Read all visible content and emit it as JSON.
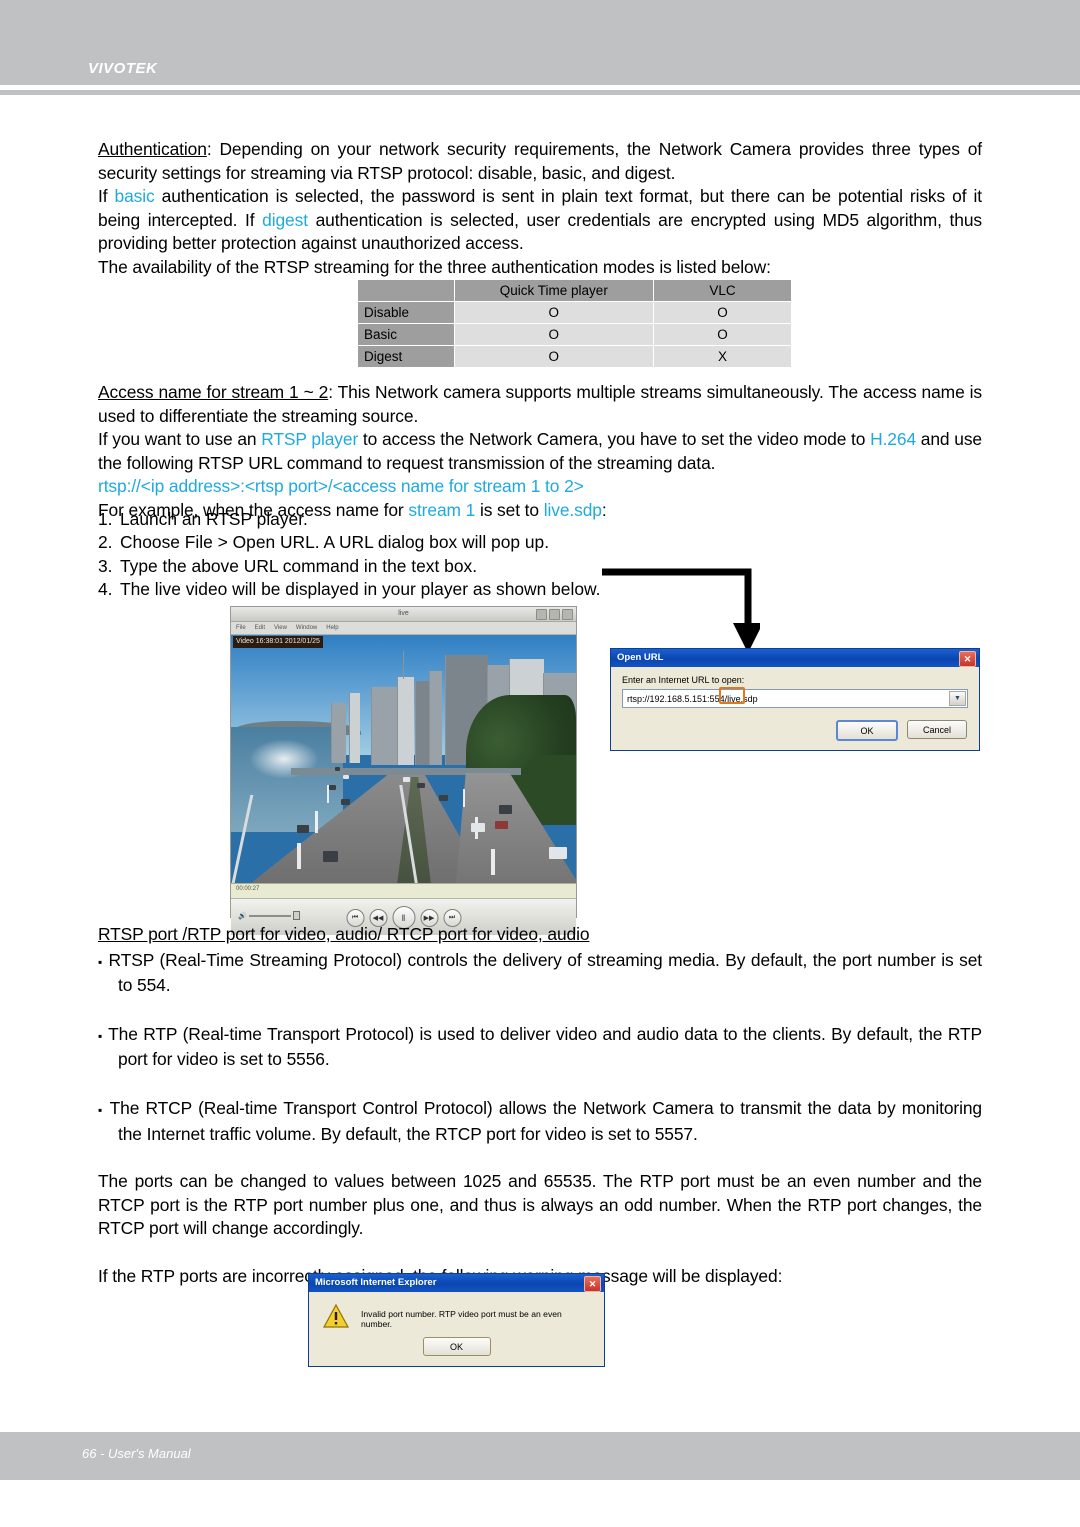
{
  "header": {
    "brand": "VIVOTEK"
  },
  "footer": {
    "page_label": "66 - User's Manual"
  },
  "body": {
    "auth_heading": "Authentication",
    "auth_p1_a": ": Depending on your network security requirements, the Network Camera provides three types of security settings for streaming via RTSP protocol: disable, basic, and digest.",
    "auth_p2_a": "If ",
    "auth_p2_basic": "basic",
    "auth_p2_b": " authentication is selected, the password is sent in plain text format, but there can be potential risks of it being intercepted. If ",
    "auth_p2_digest": "digest",
    "auth_p2_c": " authentication is selected, user credentials are encrypted using MD5 algorithm, thus providing better protection against unauthorized access.",
    "auth_p3": "The availability of the RTSP streaming for the three authentication modes is listed below:",
    "access_heading": "Access name for stream 1 ~ 2",
    "access_p1": ": This Network camera supports multiple streams simultaneously. The access name is used to differentiate the streaming source.",
    "access_p2_a": "If you want to use an ",
    "access_p2_rtsp": "RTSP player",
    "access_p2_b": " to access the Network Camera, you have to set the video mode to ",
    "access_p2_h264": "H.264",
    "access_p2_c": " and use the following RTSP URL command to request transmission of the streaming data.",
    "url_pattern": "rtsp://<ip address>:<rtsp port>/<access name for stream 1 to 2>",
    "example_a": "For example, when the access name for ",
    "example_stream": "stream 1",
    "example_b": " is set to ",
    "example_livesdp": "live.sdp",
    "example_c": ":",
    "ports_heading": "RTSP port /RTP port for video, audio/ RTCP port for video, audio",
    "bullet_rtsp": "RTSP (Real-Time Streaming Protocol) controls the delivery of streaming media. By default, the port number is set to 554.",
    "bullet_rtp": "The RTP (Real-time Transport Protocol) is used to deliver video and audio data to the clients. By default, the RTP port for video is set to 5556.",
    "bullet_rtcp": "The RTCP (Real-time Transport Control Protocol) allows the Network Camera to transmit the data by monitoring the Internet traffic volume. By default, the RTCP port for video is set to 5557.",
    "ports_range_p": "The ports can be changed to values between 1025 and 65535. The RTP port must be an even number and the RTCP port is the RTP port number plus one, and thus is always an odd number. When the RTP port changes, the RTCP port will change accordingly.",
    "warning_intro": "If the RTP ports are incorrectly assigned, the following warning message will be displayed:",
    "bullet_glyph": "▪"
  },
  "steps": [
    {
      "num": "1.",
      "text": "Launch an RTSP player."
    },
    {
      "num": "2.",
      "text": "Choose File > Open URL. A URL dialog box will pop up."
    },
    {
      "num": "3.",
      "text": "Type the above URL command in the text box."
    },
    {
      "num": "4.",
      "text": "The live video will be displayed in your player as shown below."
    }
  ],
  "availability_table": {
    "corner": "",
    "columns": [
      "Quick Time player",
      "VLC"
    ],
    "rows": [
      {
        "label": "Disable",
        "values": [
          "O",
          "O"
        ]
      },
      {
        "label": "Basic",
        "values": [
          "O",
          "O"
        ]
      },
      {
        "label": "Digest",
        "values": [
          "O",
          "X"
        ]
      }
    ],
    "header_bg": "#9e9e9e",
    "cell_bg": "#dedede"
  },
  "player": {
    "window_title": "live",
    "menu": [
      "File",
      "Edit",
      "View",
      "Window",
      "Help"
    ],
    "osd_text": "Video 16:38:01 2012/01/25",
    "timecode": "00:00:27",
    "controls": [
      {
        "name": "previous",
        "glyph": "⏮"
      },
      {
        "name": "rewind",
        "glyph": "◀◀"
      },
      {
        "name": "pause",
        "glyph": "‖"
      },
      {
        "name": "fast-forward",
        "glyph": "▶▶"
      },
      {
        "name": "next",
        "glyph": "⏭"
      }
    ],
    "volume_icon": "🔊"
  },
  "open_url_dialog": {
    "title": "Open URL",
    "close_glyph": "✕",
    "label": "Enter an Internet URL to open:",
    "url_value": "rtsp://192.168.5.151:554/live.sdp",
    "dropdown_glyph": "▼",
    "ok_label": "OK",
    "cancel_label": "Cancel",
    "highlight_color": "#e07820",
    "highlight_target": ":554"
  },
  "ie_dialog": {
    "title": "Microsoft Internet Explorer",
    "close_glyph": "✕",
    "warning_glyph": "!",
    "message": "Invalid port number. RTP video port must be an even number.",
    "ok_label": "OK"
  }
}
